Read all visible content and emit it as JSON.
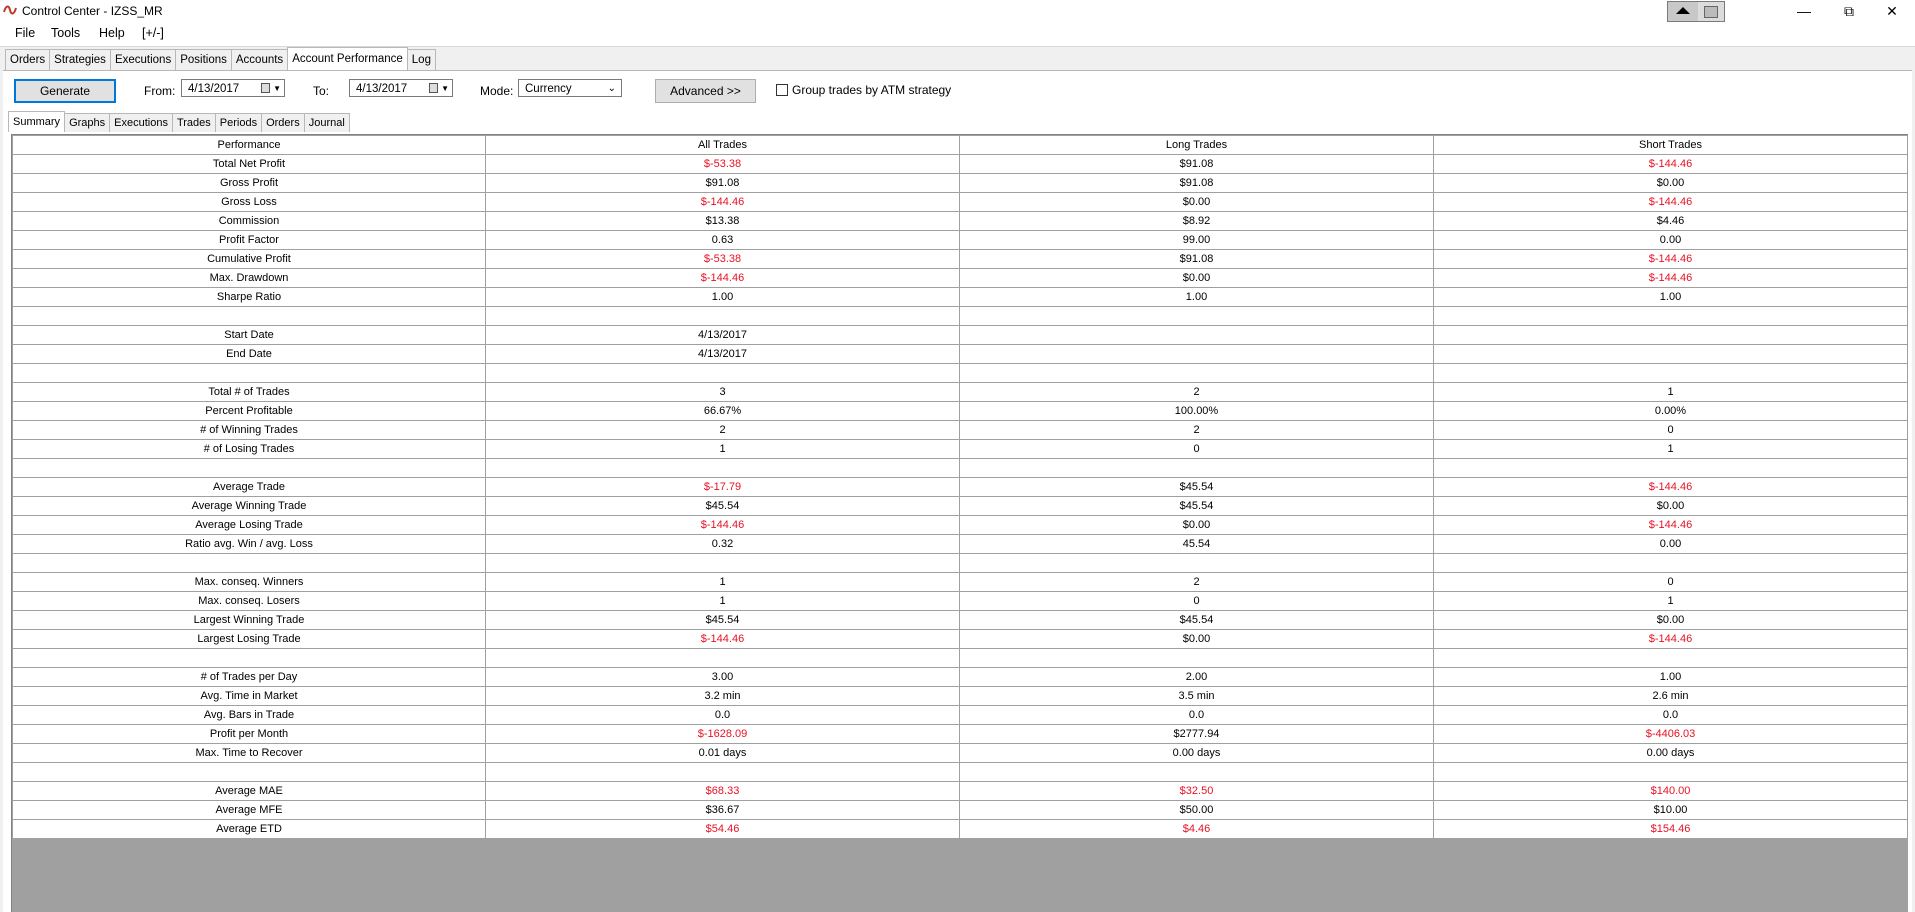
{
  "window": {
    "title": "Control Center - IZSS_MR",
    "restore_symbol": "⧉",
    "minimize_symbol": "—",
    "close_symbol": "✕"
  },
  "menu": [
    "File",
    "Tools",
    "Help",
    "[+/-]"
  ],
  "main_tabs": [
    "Orders",
    "Strategies",
    "Executions",
    "Positions",
    "Accounts",
    "Account Performance",
    "Log"
  ],
  "main_tab_active": "Account Performance",
  "toolbar": {
    "generate_label": "Generate",
    "from_label": "From:",
    "from_value": "4/13/2017",
    "to_label": "To:",
    "to_value": "4/13/2017",
    "mode_label": "Mode:",
    "mode_value": "Currency",
    "advanced_label": "Advanced >>",
    "group_trades_label": "Group trades by ATM strategy",
    "group_trades_checked": false
  },
  "sub_tabs": [
    "Summary",
    "Graphs",
    "Executions",
    "Trades",
    "Periods",
    "Orders",
    "Journal"
  ],
  "sub_tab_active": "Summary",
  "colors": {
    "negative": "#e81123",
    "accent": "#0078d7"
  },
  "table": {
    "headers": [
      "Performance",
      "All Trades",
      "Long Trades",
      "Short Trades"
    ],
    "rows": [
      [
        "Total Net Profit",
        "$-53.38",
        "$91.08",
        "$-144.46"
      ],
      [
        "Gross Profit",
        "$91.08",
        "$91.08",
        "$0.00"
      ],
      [
        "Gross Loss",
        "$-144.46",
        "$0.00",
        "$-144.46"
      ],
      [
        "Commission",
        "$13.38",
        "$8.92",
        "$4.46"
      ],
      [
        "Profit Factor",
        "0.63",
        "99.00",
        "0.00"
      ],
      [
        "Cumulative Profit",
        "$-53.38",
        "$91.08",
        "$-144.46"
      ],
      [
        "Max. Drawdown",
        "$-144.46",
        "$0.00",
        "$-144.46"
      ],
      [
        "Sharpe Ratio",
        "1.00",
        "1.00",
        "1.00"
      ],
      [
        "",
        "",
        "",
        ""
      ],
      [
        "Start Date",
        "4/13/2017",
        "",
        ""
      ],
      [
        "End Date",
        "4/13/2017",
        "",
        ""
      ],
      [
        "",
        "",
        "",
        ""
      ],
      [
        "Total # of Trades",
        "3",
        "2",
        "1"
      ],
      [
        "Percent Profitable",
        "66.67%",
        "100.00%",
        "0.00%"
      ],
      [
        "# of Winning Trades",
        "2",
        "2",
        "0"
      ],
      [
        "# of Losing Trades",
        "1",
        "0",
        "1"
      ],
      [
        "",
        "",
        "",
        ""
      ],
      [
        "Average Trade",
        "$-17.79",
        "$45.54",
        "$-144.46"
      ],
      [
        "Average Winning Trade",
        "$45.54",
        "$45.54",
        "$0.00"
      ],
      [
        "Average Losing Trade",
        "$-144.46",
        "$0.00",
        "$-144.46"
      ],
      [
        "Ratio avg. Win / avg. Loss",
        "0.32",
        "45.54",
        "0.00"
      ],
      [
        "",
        "",
        "",
        ""
      ],
      [
        "Max. conseq. Winners",
        "1",
        "2",
        "0"
      ],
      [
        "Max. conseq. Losers",
        "1",
        "0",
        "1"
      ],
      [
        "Largest Winning Trade",
        "$45.54",
        "$45.54",
        "$0.00"
      ],
      [
        "Largest Losing Trade",
        "$-144.46",
        "$0.00",
        "$-144.46"
      ],
      [
        "",
        "",
        "",
        ""
      ],
      [
        "# of Trades per Day",
        "3.00",
        "2.00",
        "1.00"
      ],
      [
        "Avg. Time in Market",
        "3.2 min",
        "3.5 min",
        "2.6 min"
      ],
      [
        "Avg. Bars in Trade",
        "0.0",
        "0.0",
        "0.0"
      ],
      [
        "Profit per Month",
        "$-1628.09",
        "$2777.94",
        "$-4406.03"
      ],
      [
        "Max. Time to Recover",
        "0.01 days",
        "0.00 days",
        "0.00 days"
      ],
      [
        "",
        "",
        "",
        ""
      ],
      [
        "Average MAE",
        "$68.33",
        "$32.50",
        "$140.00"
      ],
      [
        "Average MFE",
        "$36.67",
        "$50.00",
        "$10.00"
      ],
      [
        "Average ETD",
        "$54.46",
        "$4.46",
        "$154.46"
      ]
    ],
    "negative_cells": [
      [
        0,
        1
      ],
      [
        0,
        3
      ],
      [
        2,
        1
      ],
      [
        2,
        3
      ],
      [
        5,
        1
      ],
      [
        5,
        3
      ],
      [
        6,
        1
      ],
      [
        6,
        3
      ],
      [
        17,
        1
      ],
      [
        17,
        3
      ],
      [
        19,
        1
      ],
      [
        19,
        3
      ],
      [
        25,
        1
      ],
      [
        25,
        3
      ],
      [
        30,
        1
      ],
      [
        30,
        3
      ],
      [
        33,
        1
      ],
      [
        33,
        2
      ],
      [
        33,
        3
      ],
      [
        35,
        1
      ],
      [
        35,
        2
      ],
      [
        35,
        3
      ]
    ]
  }
}
